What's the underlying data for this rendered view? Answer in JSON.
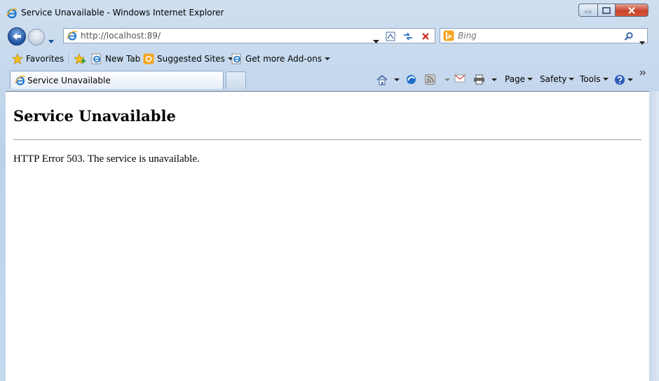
{
  "window": {
    "title": "Service Unavailable - Windows Internet Explorer",
    "colors": {
      "frame": "#c5d8ee",
      "close_button": "#c9462c",
      "back_button": "#1c4f9c"
    }
  },
  "navbar": {
    "address_value": "http://localhost:89/",
    "search_placeholder": "Bing"
  },
  "favorites_bar": {
    "favorites_label": "Favorites",
    "items": [
      "New Tab",
      "Suggested Sites",
      "Get more Add-ons"
    ]
  },
  "tabs": [
    {
      "label": "Service Unavailable",
      "active": true
    }
  ],
  "command_bar": {
    "page_label": "Page",
    "safety_label": "Safety",
    "tools_label": "Tools"
  },
  "content": {
    "heading": "Service Unavailable",
    "message": "HTTP Error 503. The service is unavailable."
  }
}
